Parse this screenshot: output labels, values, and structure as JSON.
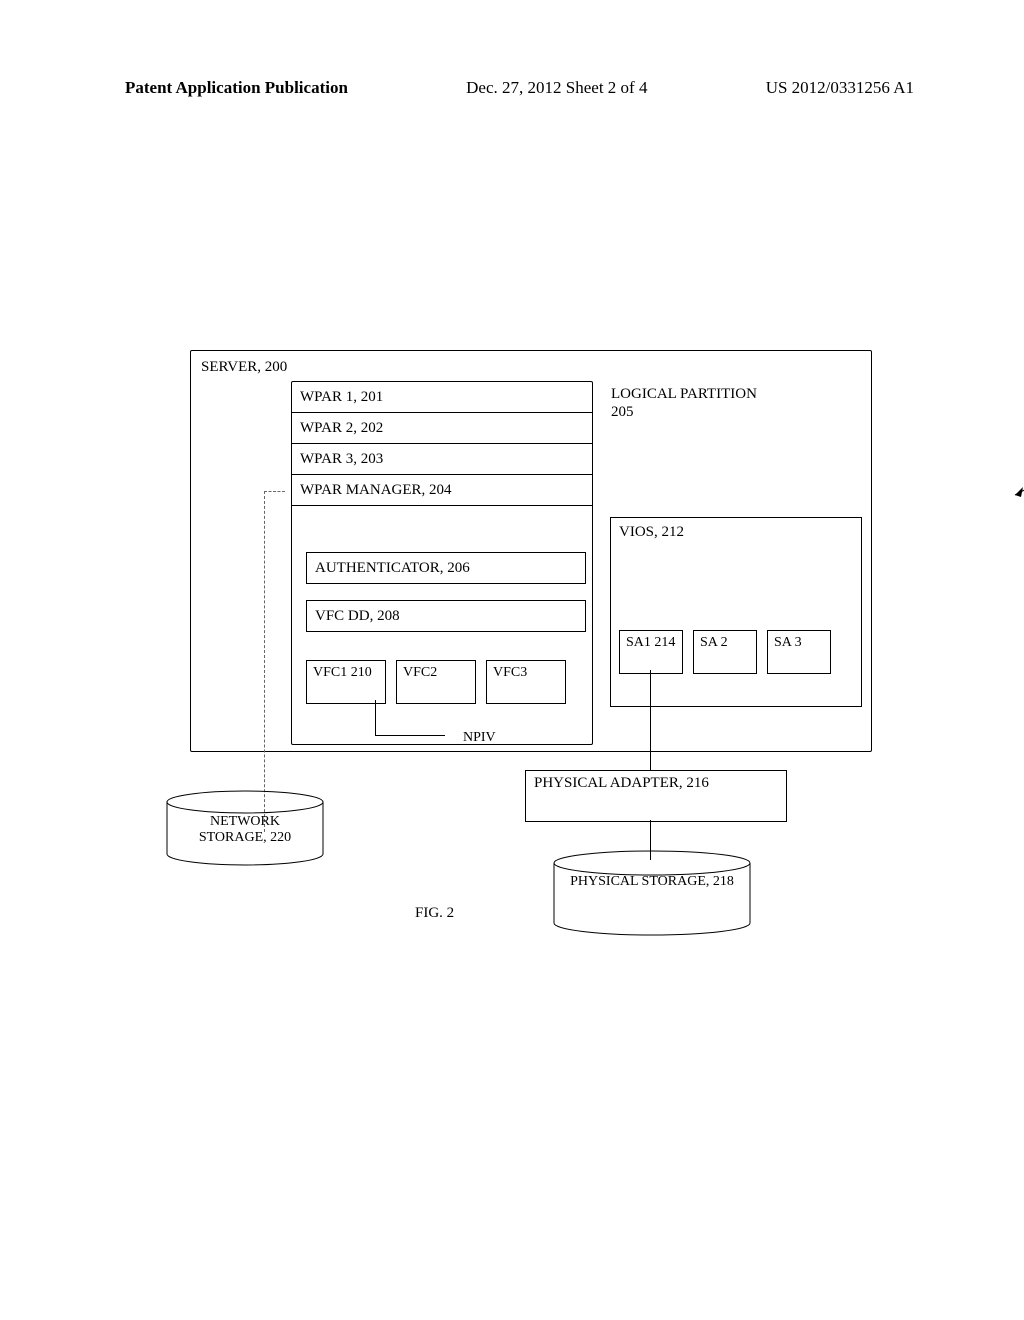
{
  "header": {
    "left": "Patent Application Publication",
    "center": "Dec. 27, 2012  Sheet 2 of 4",
    "right": "US 2012/0331256 A1"
  },
  "server": {
    "title": "SERVER, 200",
    "left_group": {
      "wpar1": "WPAR 1, 201",
      "wpar2": "WPAR 2, 202",
      "wpar3": "WPAR 3, 203",
      "wpar_manager": "WPAR MANAGER, 204",
      "authenticator": "AUTHENTICATOR, 206",
      "vfc_dd": "VFC DD, 208",
      "vfc1": "VFC1 210",
      "vfc2": "VFC2",
      "vfc3": "VFC3"
    },
    "logical_partition_label": "LOGICAL PARTITION 205",
    "vios": {
      "label": "VIOS, 212",
      "sa1": "SA1 214",
      "sa2": "SA 2",
      "sa3": "SA 3"
    },
    "npiv": "NPIV"
  },
  "physical_adapter": "PHYSICAL ADAPTER, 216",
  "physical_storage": "PHYSICAL STORAGE, 218",
  "network_storage": "NETWORK STORAGE, 220",
  "figure_caption": "FIG. 2"
}
